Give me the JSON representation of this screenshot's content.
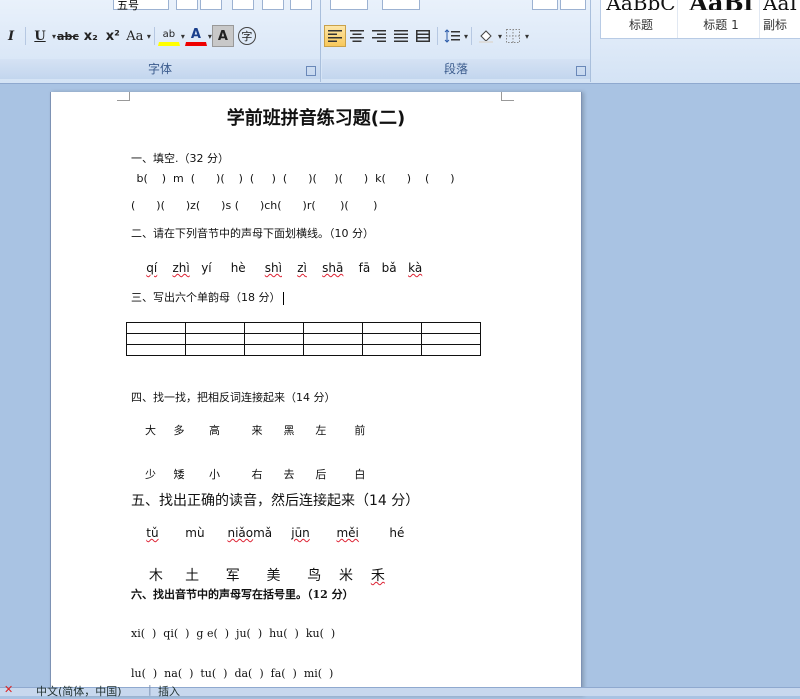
{
  "ribbon": {
    "font_group": {
      "label": "字体",
      "font_size": "五号",
      "buttons": [
        {
          "name": "italic-button",
          "label": "I"
        },
        {
          "name": "underline-button",
          "label": "U"
        },
        {
          "name": "strikethrough-button",
          "label": "abc"
        },
        {
          "name": "subscript-button",
          "label": "x₂"
        },
        {
          "name": "superscript-button",
          "label": "x²"
        },
        {
          "name": "change-case-button",
          "label": "Aa"
        },
        {
          "name": "highlight-button",
          "label": "ab"
        },
        {
          "name": "font-color-button",
          "label": "A"
        },
        {
          "name": "char-shading-button",
          "label": "A"
        },
        {
          "name": "enclose-char-button",
          "label": "字"
        }
      ]
    },
    "paragraph_group": {
      "label": "段落"
    },
    "styles": [
      {
        "sample": "AaBbC",
        "name": "标题"
      },
      {
        "sample": "AaBl",
        "name": "标题 1"
      },
      {
        "sample": "AaI",
        "name": "副标"
      }
    ]
  },
  "document": {
    "title": "学前班拼音练习题(二)",
    "q1": {
      "heading": "一、填空.（32 分）",
      "row1": [
        "b(",
        ")",
        "m",
        "(",
        ")(",
        ")",
        "(",
        ")",
        "(",
        ")",
        "(",
        ")(",
        ")",
        "k(",
        ")",
        "(",
        ")"
      ],
      "row1_text": " b(    )  m  (      )(    )  (     )  (      )(     )(      )  k(      )    (      )",
      "row2_text": "(      )(      )z(      )s (      )ch(      )r(       )(       )"
    },
    "q2": {
      "heading": "二、请在下列音节中的声母下面划横线。（10 分）",
      "syllables": [
        "qí",
        "zhì",
        "yí",
        "hè",
        "shì",
        "zì",
        "shā",
        "fā",
        "bǎ",
        "kà"
      ]
    },
    "q3": {
      "heading": "三、写出六个单韵母（18 分）"
    },
    "q4": {
      "heading": "四、找一找，把相反词连接起来（14 分）",
      "row1": [
        "大",
        "多",
        "高",
        "来",
        "黑",
        "左",
        "前"
      ],
      "row2": [
        "少",
        "矮",
        "小",
        "右",
        "去",
        "后",
        "白"
      ]
    },
    "q5": {
      "heading": "五、找出正确的读音，然后连接起来（14 分）",
      "pinyin": [
        "tǔ",
        "mù",
        "niǎo",
        "mǎ",
        "jūn",
        "měi",
        "hé"
      ],
      "chars": [
        "木",
        "土",
        "军",
        "美",
        "鸟",
        "米",
        "禾"
      ]
    },
    "q6": {
      "heading": "六、找出音节中的声母写在括号里。（12 分）",
      "row1_text": "xi(  )  qi(  )  g e(  )  ju(  )  hu(  )  ku(  )",
      "row2_text": "lu(  )  na(  )  tu(  )  da(  )  fa(  )  mi(  )"
    }
  },
  "status_bar": {
    "language": "中文(简体，中国)",
    "mode": "插入"
  }
}
